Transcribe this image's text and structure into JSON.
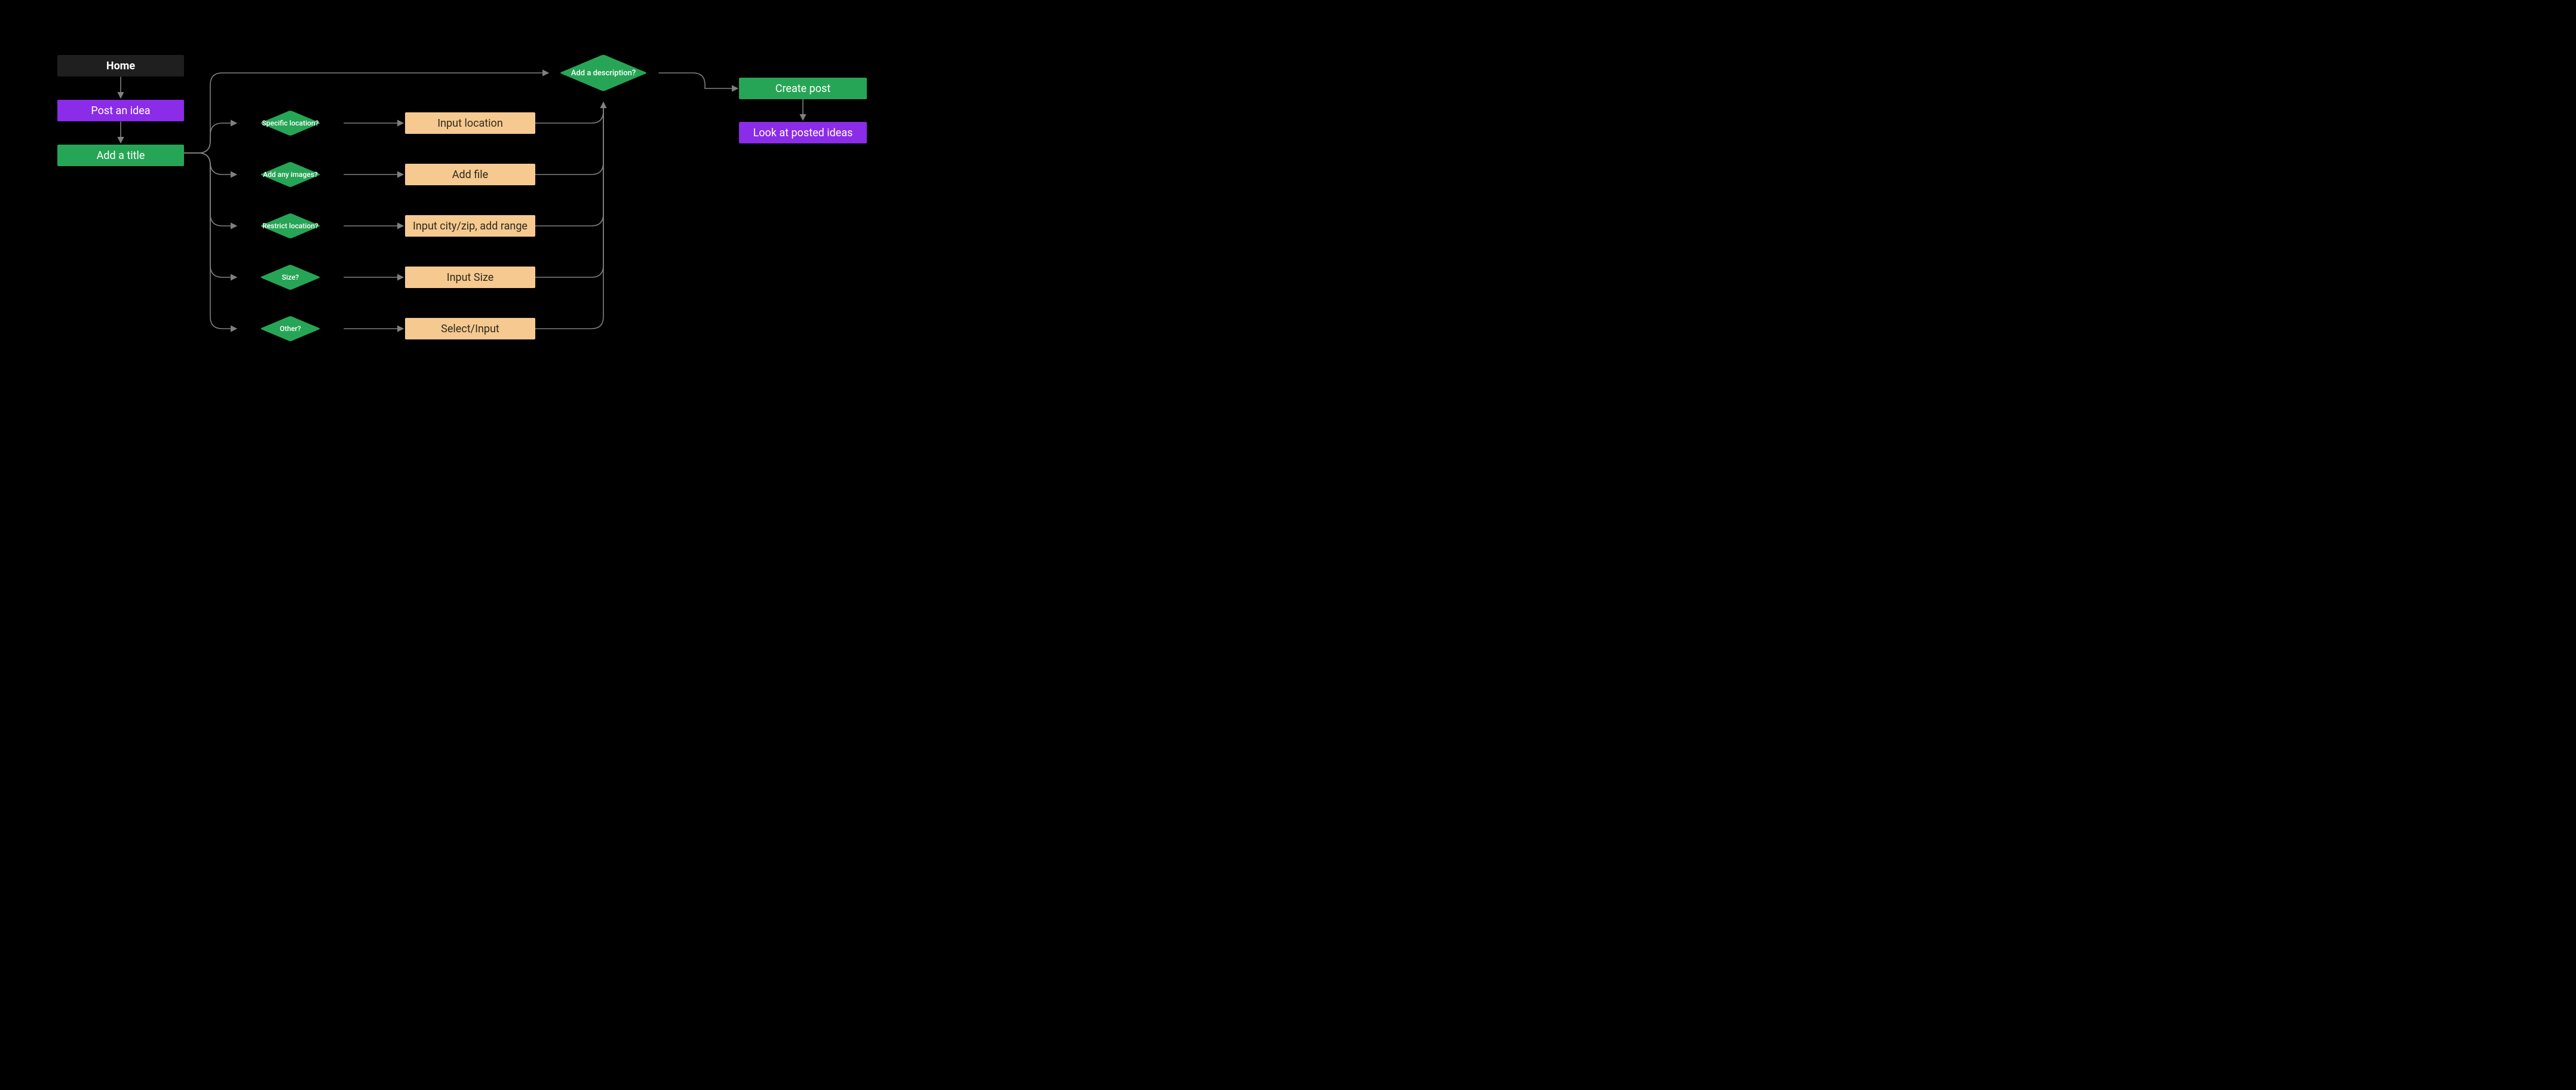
{
  "colors": {
    "background": "#000000",
    "home_bg": "#1f1f1f",
    "purple": "#8b2ce8",
    "green": "#27a556",
    "orange": "#f5c990",
    "connector": "#808080"
  },
  "flow": {
    "home": "Home",
    "post_idea": "Post an idea",
    "add_title": "Add a title",
    "decisions": {
      "specific_location": "Specific location?",
      "add_images": "Add any images?",
      "restrict_location": "Restrict location?",
      "size": "Size?",
      "other": "Other?",
      "add_description": "Add a description?"
    },
    "inputs": {
      "input_location": "Input location",
      "add_file": "Add file",
      "input_city_zip": "Input city/zip, add range",
      "input_size": "Input Size",
      "select_input": "Select/Input"
    },
    "create_post": "Create post",
    "look_at_posted": "Look at posted ideas"
  }
}
